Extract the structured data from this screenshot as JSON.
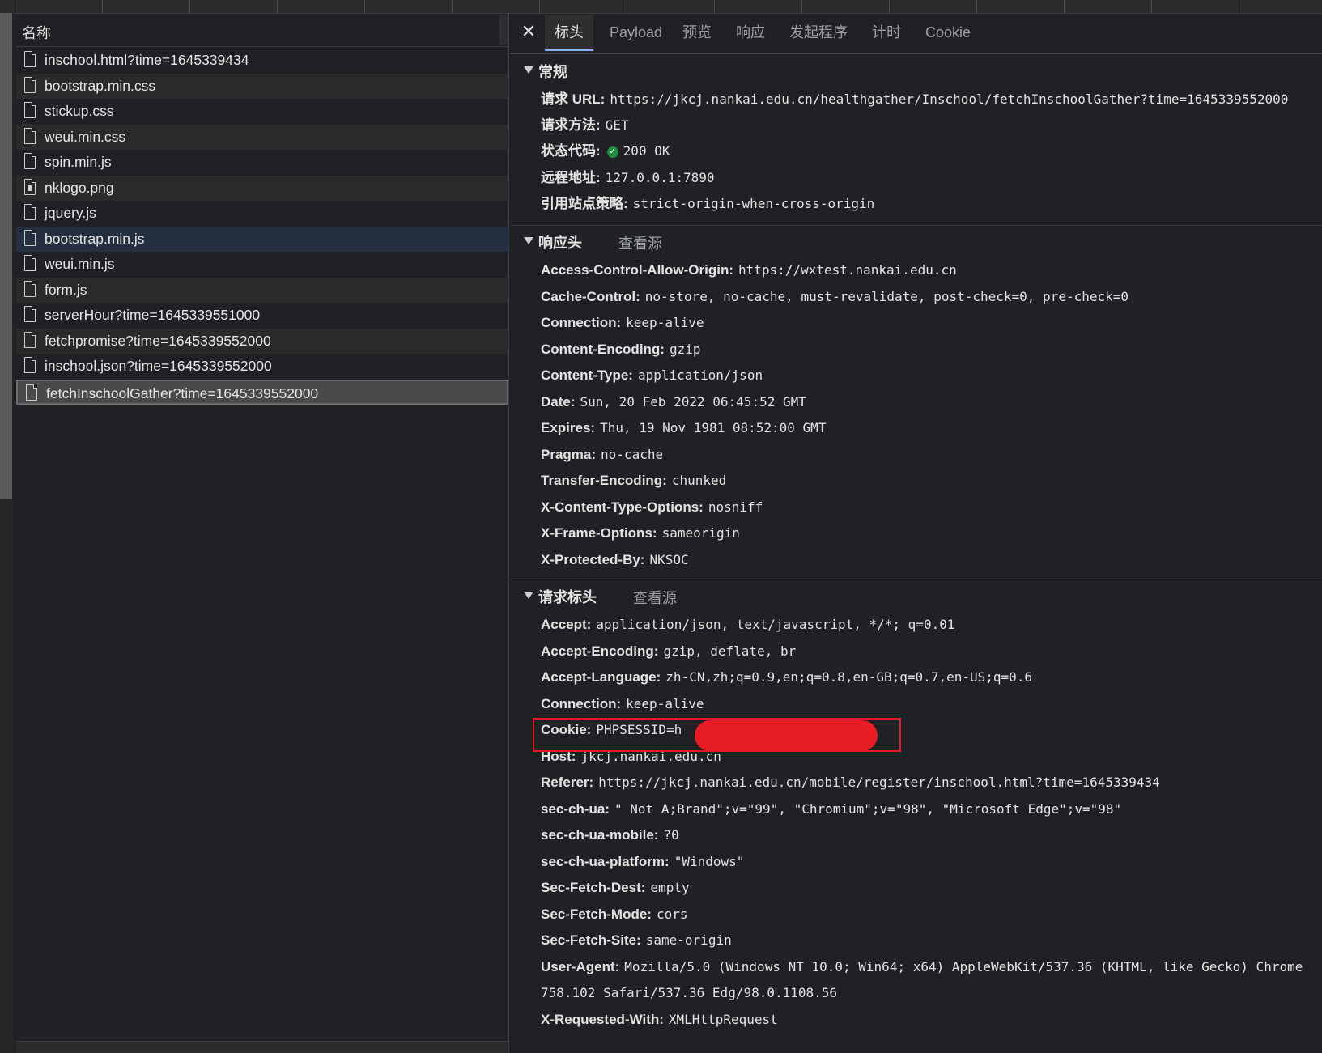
{
  "left": {
    "header": "名称",
    "files": [
      {
        "name": "inschool.html?time=1645339434",
        "icon": "document-icon"
      },
      {
        "name": "bootstrap.min.css",
        "icon": "document-icon"
      },
      {
        "name": "stickup.css",
        "icon": "document-icon"
      },
      {
        "name": "weui.min.css",
        "icon": "document-icon"
      },
      {
        "name": "spin.min.js",
        "icon": "document-icon"
      },
      {
        "name": "nklogo.png",
        "icon": "image-icon"
      },
      {
        "name": "jquery.js",
        "icon": "document-icon"
      },
      {
        "name": "bootstrap.min.js",
        "icon": "document-icon"
      },
      {
        "name": "weui.min.js",
        "icon": "document-icon"
      },
      {
        "name": "form.js",
        "icon": "document-icon"
      },
      {
        "name": "serverHour?time=1645339551000",
        "icon": "document-icon"
      },
      {
        "name": "fetchpromise?time=1645339552000",
        "icon": "document-icon"
      },
      {
        "name": "inschool.json?time=1645339552000",
        "icon": "document-icon"
      },
      {
        "name": "fetchInschoolGather?time=1645339552000",
        "icon": "document-icon"
      }
    ]
  },
  "tabs": [
    "标头",
    "Payload",
    "预览",
    "响应",
    "发起程序",
    "计时",
    "Cookie"
  ],
  "general": {
    "title": "常规",
    "rows": [
      {
        "k": "请求 URL:",
        "v": "https://jkcj.nankai.edu.cn/healthgather/Inschool/fetchInschoolGather?time=1645339552000"
      },
      {
        "k": "请求方法:",
        "v": "GET"
      },
      {
        "k": "状态代码:",
        "v": "200 OK"
      },
      {
        "k": "远程地址:",
        "v": "127.0.0.1:7890"
      },
      {
        "k": "引用站点策略:",
        "v": "strict-origin-when-cross-origin"
      }
    ]
  },
  "response_headers": {
    "title": "响应头",
    "view_source": "查看源",
    "rows": [
      {
        "k": "Access-Control-Allow-Origin:",
        "v": "https://wxtest.nankai.edu.cn"
      },
      {
        "k": "Cache-Control:",
        "v": "no-store, no-cache, must-revalidate, post-check=0, pre-check=0"
      },
      {
        "k": "Connection:",
        "v": "keep-alive"
      },
      {
        "k": "Content-Encoding:",
        "v": "gzip"
      },
      {
        "k": "Content-Type:",
        "v": "application/json"
      },
      {
        "k": "Date:",
        "v": "Sun, 20 Feb 2022 06:45:52 GMT"
      },
      {
        "k": "Expires:",
        "v": "Thu, 19 Nov 1981 08:52:00 GMT"
      },
      {
        "k": "Pragma:",
        "v": "no-cache"
      },
      {
        "k": "Transfer-Encoding:",
        "v": "chunked"
      },
      {
        "k": "X-Content-Type-Options:",
        "v": "nosniff"
      },
      {
        "k": "X-Frame-Options:",
        "v": "sameorigin"
      },
      {
        "k": "X-Protected-By:",
        "v": "NKSOC"
      }
    ]
  },
  "request_headers": {
    "title": "请求标头",
    "view_source": "查看源",
    "rows": [
      {
        "k": "Accept:",
        "v": "application/json, text/javascript, */*; q=0.01"
      },
      {
        "k": "Accept-Encoding:",
        "v": "gzip, deflate, br"
      },
      {
        "k": "Accept-Language:",
        "v": "zh-CN,zh;q=0.9,en;q=0.8,en-GB;q=0.7,en-US;q=0.6"
      },
      {
        "k": "Connection:",
        "v": "keep-alive"
      },
      {
        "k": "Cookie:",
        "v": "PHPSESSID=h"
      },
      {
        "k": "Host:",
        "v": "jkcj.nankai.edu.cn"
      },
      {
        "k": "Referer:",
        "v": "https://jkcj.nankai.edu.cn/mobile/register/inschool.html?time=1645339434"
      },
      {
        "k": "sec-ch-ua:",
        "v": "\" Not A;Brand\";v=\"99\", \"Chromium\";v=\"98\", \"Microsoft Edge\";v=\"98\""
      },
      {
        "k": "sec-ch-ua-mobile:",
        "v": "?0"
      },
      {
        "k": "sec-ch-ua-platform:",
        "v": "\"Windows\""
      },
      {
        "k": "Sec-Fetch-Dest:",
        "v": "empty"
      },
      {
        "k": "Sec-Fetch-Mode:",
        "v": "cors"
      },
      {
        "k": "Sec-Fetch-Site:",
        "v": "same-origin"
      },
      {
        "k": "User-Agent:",
        "v": "Mozilla/5.0 (Windows NT 10.0; Win64; x64) AppleWebKit/537.36 (KHTML, like Gecko) Chrome"
      },
      {
        "k": "",
        "v": "758.102 Safari/537.36 Edg/98.0.1108.56"
      },
      {
        "k": "X-Requested-With:",
        "v": "XMLHttpRequest"
      }
    ]
  },
  "colors": {
    "accent": "#8ab4f8",
    "status_ok": "#1e8e3e",
    "highlight": "#e01b24"
  }
}
